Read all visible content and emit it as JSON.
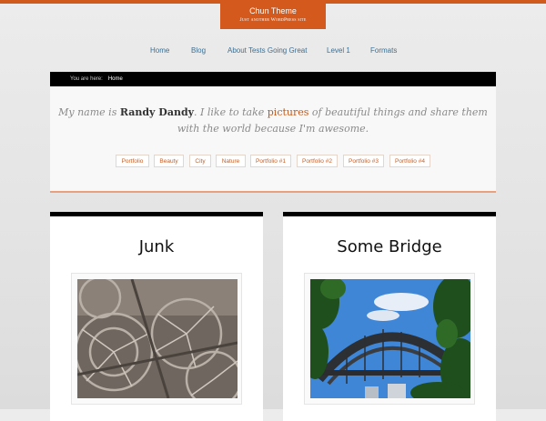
{
  "site": {
    "title": "Chun Theme",
    "tagline": "Just another WordPress site"
  },
  "nav": [
    "Home",
    "Blog",
    "About Tests Going Great",
    "Level 1",
    "Formats"
  ],
  "breadcrumb": {
    "label": "You are here:",
    "current": "Home"
  },
  "intro": {
    "prefix": "My name is ",
    "name": "Randy Dandy",
    "middle": ". I like to take ",
    "link": "pictures",
    "suffix": " of beautiful things and share them with the world because I'm awesome."
  },
  "tags": [
    "Portfolio",
    "Beauty",
    "City",
    "Nature",
    "Portfolio #1",
    "Portfolio #2",
    "Portfolio #3",
    "Portfolio #4"
  ],
  "cards": [
    {
      "title": "Junk",
      "image_icon": "wheels-photo"
    },
    {
      "title": "Some Bridge",
      "image_icon": "bridge-photo"
    }
  ],
  "colors": {
    "accent": "#d4591c",
    "link": "#c25a1c",
    "nav": "#3d6f92"
  }
}
